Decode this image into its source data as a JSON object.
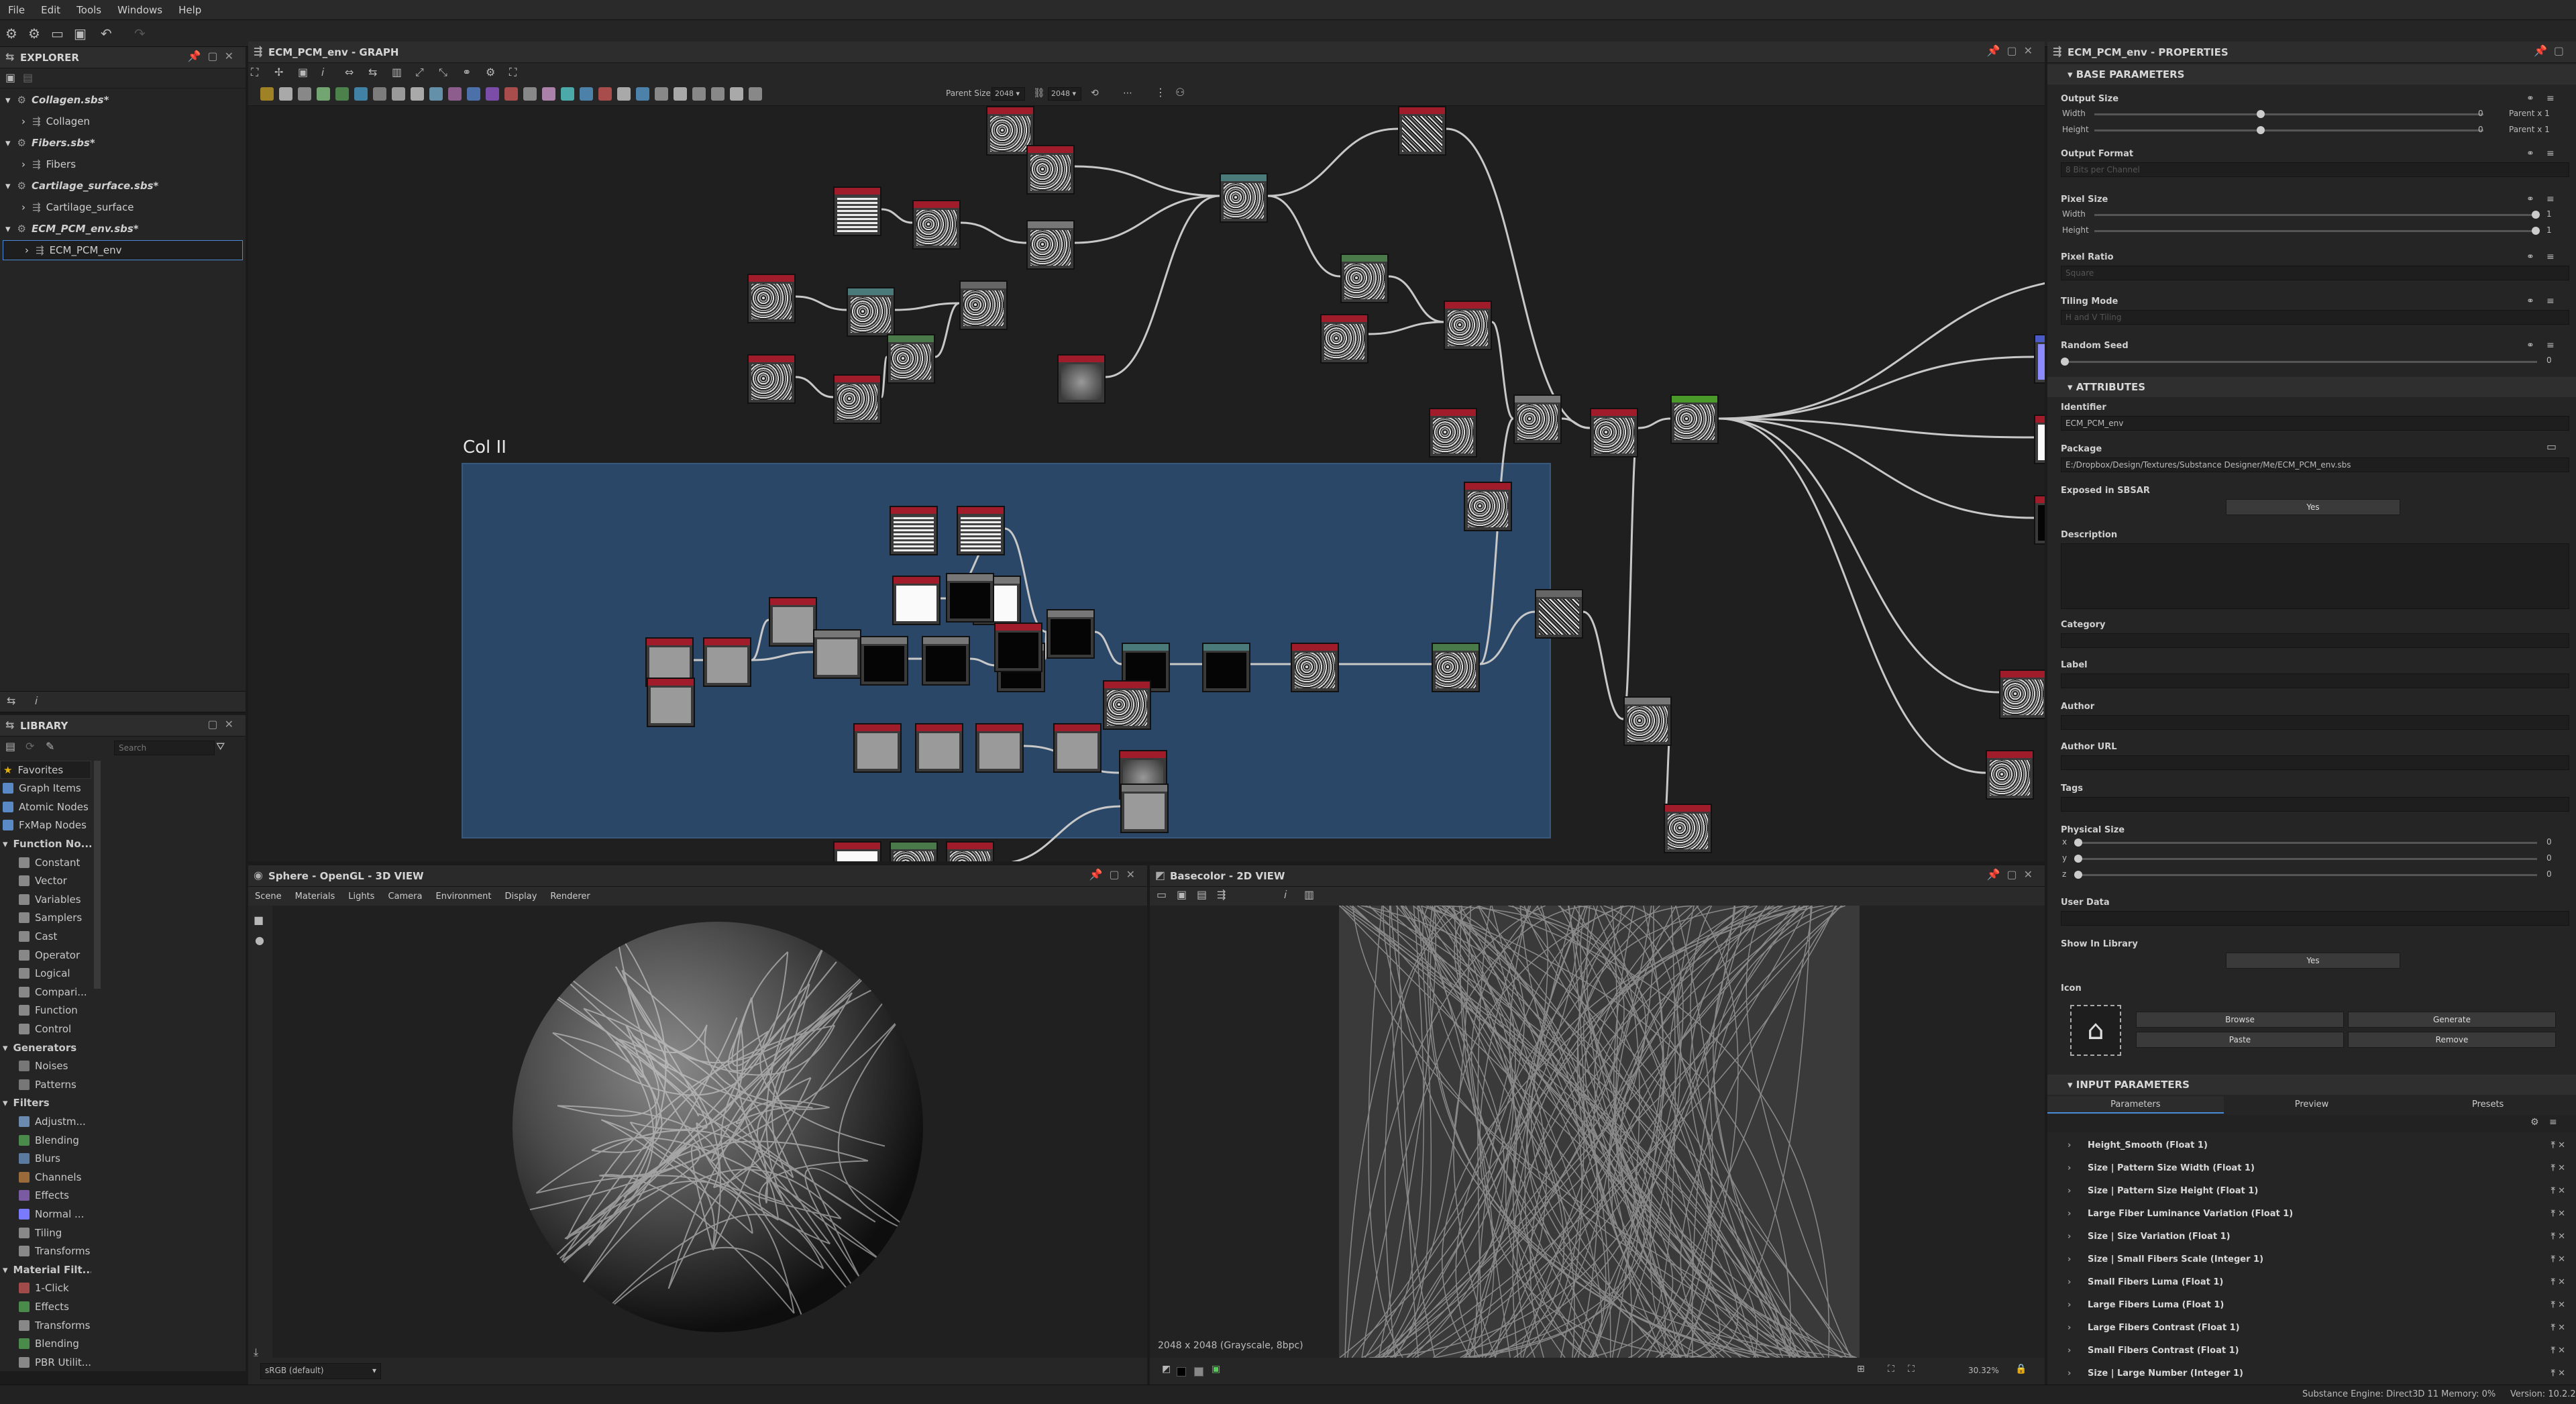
{
  "menu": [
    "File",
    "Edit",
    "Tools",
    "Windows",
    "Help"
  ],
  "explorer": {
    "title": "EXPLORER",
    "items": [
      {
        "label": "Collagen.sbs*",
        "level": 0
      },
      {
        "label": "Collagen",
        "level": 1
      },
      {
        "label": "Fibers.sbs*",
        "level": 0
      },
      {
        "label": "Fibers",
        "level": 1
      },
      {
        "label": "Cartilage_surface.sbs*",
        "level": 0
      },
      {
        "label": "Cartilage_surface",
        "level": 1
      },
      {
        "label": "ECM_PCM_env.sbs*",
        "level": 0
      },
      {
        "label": "ECM_PCM_env",
        "level": 1
      }
    ]
  },
  "library": {
    "title": "LIBRARY",
    "search_placeholder": "Search",
    "items": [
      {
        "label": "Favorites",
        "kind": "star",
        "color": "#e8b000"
      },
      {
        "label": "Graph Items",
        "kind": "sub",
        "color": "#5a8ac6"
      },
      {
        "label": "Atomic Nodes",
        "kind": "sub",
        "color": "#5a8ac6"
      },
      {
        "label": "FxMap Nodes",
        "kind": "sub",
        "color": "#5a8ac6"
      },
      {
        "label": "Function No...",
        "kind": "head",
        "color": ""
      },
      {
        "label": "Constant",
        "kind": "sub",
        "color": "#888"
      },
      {
        "label": "Vector",
        "kind": "sub",
        "color": "#888"
      },
      {
        "label": "Variables",
        "kind": "sub",
        "color": "#888"
      },
      {
        "label": "Samplers",
        "kind": "sub",
        "color": "#888"
      },
      {
        "label": "Cast",
        "kind": "sub",
        "color": "#888"
      },
      {
        "label": "Operator",
        "kind": "sub",
        "color": "#888"
      },
      {
        "label": "Logical",
        "kind": "sub",
        "color": "#888"
      },
      {
        "label": "Compari...",
        "kind": "sub",
        "color": "#888"
      },
      {
        "label": "Function",
        "kind": "sub",
        "color": "#888"
      },
      {
        "label": "Control",
        "kind": "sub",
        "color": "#888"
      },
      {
        "label": "Generators",
        "kind": "head",
        "color": ""
      },
      {
        "label": "Noises",
        "kind": "sub",
        "color": "#777"
      },
      {
        "label": "Patterns",
        "kind": "sub",
        "color": "#777"
      },
      {
        "label": "Filters",
        "kind": "head",
        "color": ""
      },
      {
        "label": "Adjustm...",
        "kind": "sub",
        "color": "#6a8ab0"
      },
      {
        "label": "Blending",
        "kind": "sub",
        "color": "#4a8a4a"
      },
      {
        "label": "Blurs",
        "kind": "sub",
        "color": "#5a7aa0"
      },
      {
        "label": "Channels",
        "kind": "sub",
        "color": "#9a6a3a"
      },
      {
        "label": "Effects",
        "kind": "sub",
        "color": "#7a5aa0"
      },
      {
        "label": "Normal ...",
        "kind": "sub",
        "color": "#7a7aff"
      },
      {
        "label": "Tiling",
        "kind": "sub",
        "color": "#888"
      },
      {
        "label": "Transforms",
        "kind": "sub",
        "color": "#888"
      },
      {
        "label": "Material Filt...",
        "kind": "head",
        "color": ""
      },
      {
        "label": "1-Click",
        "kind": "sub",
        "color": "#a04a4a"
      },
      {
        "label": "Effects",
        "kind": "sub",
        "color": "#4a8a4a"
      },
      {
        "label": "Transforms",
        "kind": "sub",
        "color": "#888"
      },
      {
        "label": "Blending",
        "kind": "sub",
        "color": "#4a8a4a"
      },
      {
        "label": "PBR Utilit...",
        "kind": "sub",
        "color": "#888"
      }
    ]
  },
  "graph": {
    "title": "ECM_PCM_env - GRAPH",
    "parent_size_label": "Parent Size:",
    "parent_size": "2048",
    "size2": "2048",
    "frame_title": "Col II"
  },
  "view3d": {
    "title": "Sphere - OpenGL - 3D VIEW",
    "menu": [
      "Scene",
      "Materials",
      "Lights",
      "Camera",
      "Environment",
      "Display",
      "Renderer"
    ],
    "colorspace": "sRGB (default)"
  },
  "view2d": {
    "title": "Basecolor - 2D VIEW",
    "info": "2048 x 2048 (Grayscale, 8bpc)",
    "zoom": "30.32%"
  },
  "properties": {
    "title": "ECM_PCM_env - PROPERTIES",
    "base_section": "BASE PARAMETERS",
    "output_size": "Output Size",
    "width": "Width",
    "height": "Height",
    "parent_x1": "Parent x 1",
    "zero": "0",
    "output_format": "Output Format",
    "output_format_val": "8 Bits per Channel",
    "pixel_size": "Pixel Size",
    "one": "1",
    "pixel_ratio": "Pixel Ratio",
    "pixel_ratio_val": "Square",
    "tiling_mode": "Tiling Mode",
    "tiling_mode_val": "H and V Tiling",
    "random_seed": "Random Seed",
    "attr_section": "ATTRIBUTES",
    "identifier": "Identifier",
    "identifier_val": "ECM_PCM_env",
    "package": "Package",
    "package_val": "E:/Dropbox/Design/Textures/Substance Designer/Me/ECM_PCM_env.sbs",
    "exposed": "Exposed in SBSAR",
    "yes": "Yes",
    "description": "Description",
    "category": "Category",
    "label": "Label",
    "author": "Author",
    "author_url": "Author URL",
    "tags": "Tags",
    "physical_size": "Physical Size",
    "x": "x",
    "y": "y",
    "z": "z",
    "user_data": "User Data",
    "show_in_library": "Show In Library",
    "icon": "Icon",
    "browse": "Browse",
    "generate": "Generate",
    "paste": "Paste",
    "remove": "Remove",
    "input_section": "INPUT PARAMETERS",
    "tabs": [
      "Parameters",
      "Preview",
      "Presets"
    ],
    "params": [
      "Height_Smooth (Float 1)",
      "Size | Pattern Size Width (Float 1)",
      "Size | Pattern Size Height (Float 1)",
      "Large Fiber Luminance Variation (Float 1)",
      "Size | Size Variation (Float 1)",
      "Size | Small Fibers Scale (Integer 1)",
      "Small Fibers Luma (Float 1)",
      "Large Fibers Luma (Float 1)",
      "Large Fibers Contrast (Float 1)",
      "Small Fibers Contrast (Float 1)",
      "Size | Large Number (Integer 1)"
    ]
  },
  "status": {
    "engine": "Substance Engine: Direct3D 11  Memory: 0%",
    "version": "Version: 10.2.2"
  }
}
